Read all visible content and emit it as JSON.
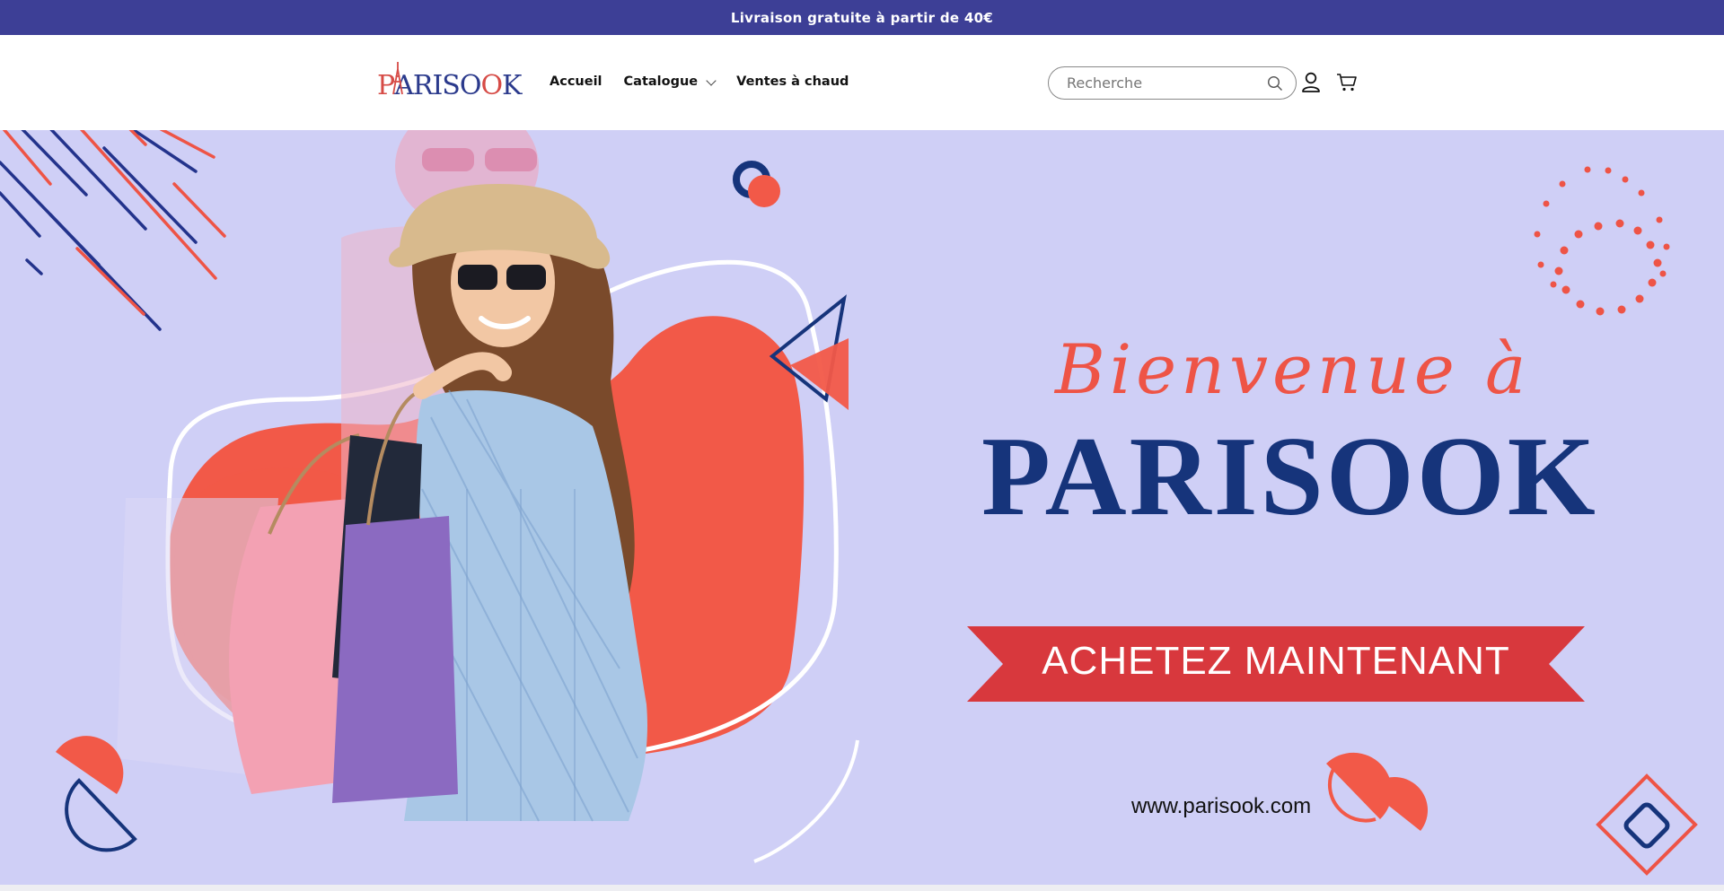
{
  "announcement": {
    "text": "Livraison gratuite à partir de 40€"
  },
  "header": {
    "logo_parts": [
      "P",
      "ARISO",
      "O",
      "K"
    ],
    "nav": [
      {
        "label": "Accueil"
      },
      {
        "label": "Catalogue",
        "has_dropdown": true
      },
      {
        "label": "Ventes à chaud"
      }
    ],
    "search": {
      "placeholder": "Recherche"
    },
    "icons": [
      "search-icon",
      "account-icon",
      "cart-icon"
    ]
  },
  "hero": {
    "welcome": "Bienvenue à",
    "brand": "PARISOOK",
    "cta_label": "ACHETEZ MAINTENANT",
    "website": "www.parisook.com"
  },
  "colors": {
    "announcement_bg": "#3d3f96",
    "hero_bg": "#cfcff6",
    "accent_coral": "#ee5446",
    "navy": "#16347b",
    "cta_red": "#d8383d"
  }
}
